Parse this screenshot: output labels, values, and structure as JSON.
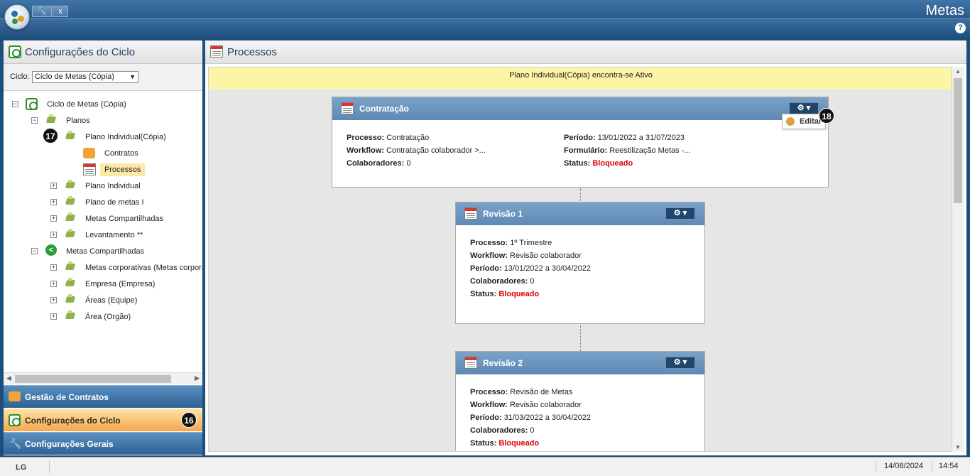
{
  "app": {
    "title": "Metas",
    "tab_close": "x",
    "help": "?"
  },
  "left": {
    "title": "Configurações do Ciclo",
    "ciclo_label": "Ciclo:",
    "ciclo_value": "Ciclo de Metas (Cópia)",
    "tree": {
      "root": "Ciclo de Metas (Cópia)",
      "planos": "Planos",
      "plano_individual_copia": "Plano Individual(Cópia)",
      "contratos": "Contratos",
      "processos": "Processos",
      "plano_individual": "Plano Individual",
      "plano_metas_i": "Plano de metas I",
      "metas_compartilhadas_1": "Metas Compartilhadas",
      "levantamento": "Levantamento **",
      "metas_compartilhadas_2": "Metas Compartilhadas",
      "metas_corporativas": "Metas corporativas (Metas corpora",
      "empresa": "Empresa (Empresa)",
      "areas": "Áreas (Equipe)",
      "area_orgao": "Área (Orgão)"
    },
    "accordion": {
      "gestao": "Gestão de Contratos",
      "config_ciclo": "Configurações do Ciclo",
      "config_gerais": "Configurações Gerais"
    },
    "badges": {
      "b16": "16",
      "b17": "17"
    }
  },
  "right": {
    "title": "Processos",
    "banner": "Plano Individual(Cópia) encontra-se Ativo",
    "edit_label": "Editar",
    "badge18": "18",
    "labels": {
      "processo": "Processo:",
      "workflow": "Workflow:",
      "colaboradores": "Colaboradores:",
      "periodo": "Período:",
      "formulario": "Formulário:",
      "status": "Status:"
    },
    "cards": [
      {
        "title": "Contratação",
        "processo": "Contratação",
        "workflow": "Contratação colaborador >...",
        "colaboradores": "0",
        "periodo": "13/01/2022 a 31/07/2023",
        "formulario": "Reestilização Metas -...",
        "status": "Bloqueado"
      },
      {
        "title": "Revisão 1",
        "processo": "1º Trimestre",
        "workflow": "Revisão colaborador",
        "periodo": "13/01/2022 a 30/04/2022",
        "colaboradores": "0",
        "status": "Bloqueado"
      },
      {
        "title": "Revisão 2",
        "processo": "Revisão de Metas",
        "workflow": "Revisão colaborador",
        "periodo": "31/03/2022 a 30/04/2022",
        "colaboradores": "0",
        "status": "Bloqueado"
      }
    ]
  },
  "status_bar": {
    "logo": "LG",
    "date": "14/08/2024",
    "time": "14:54"
  }
}
